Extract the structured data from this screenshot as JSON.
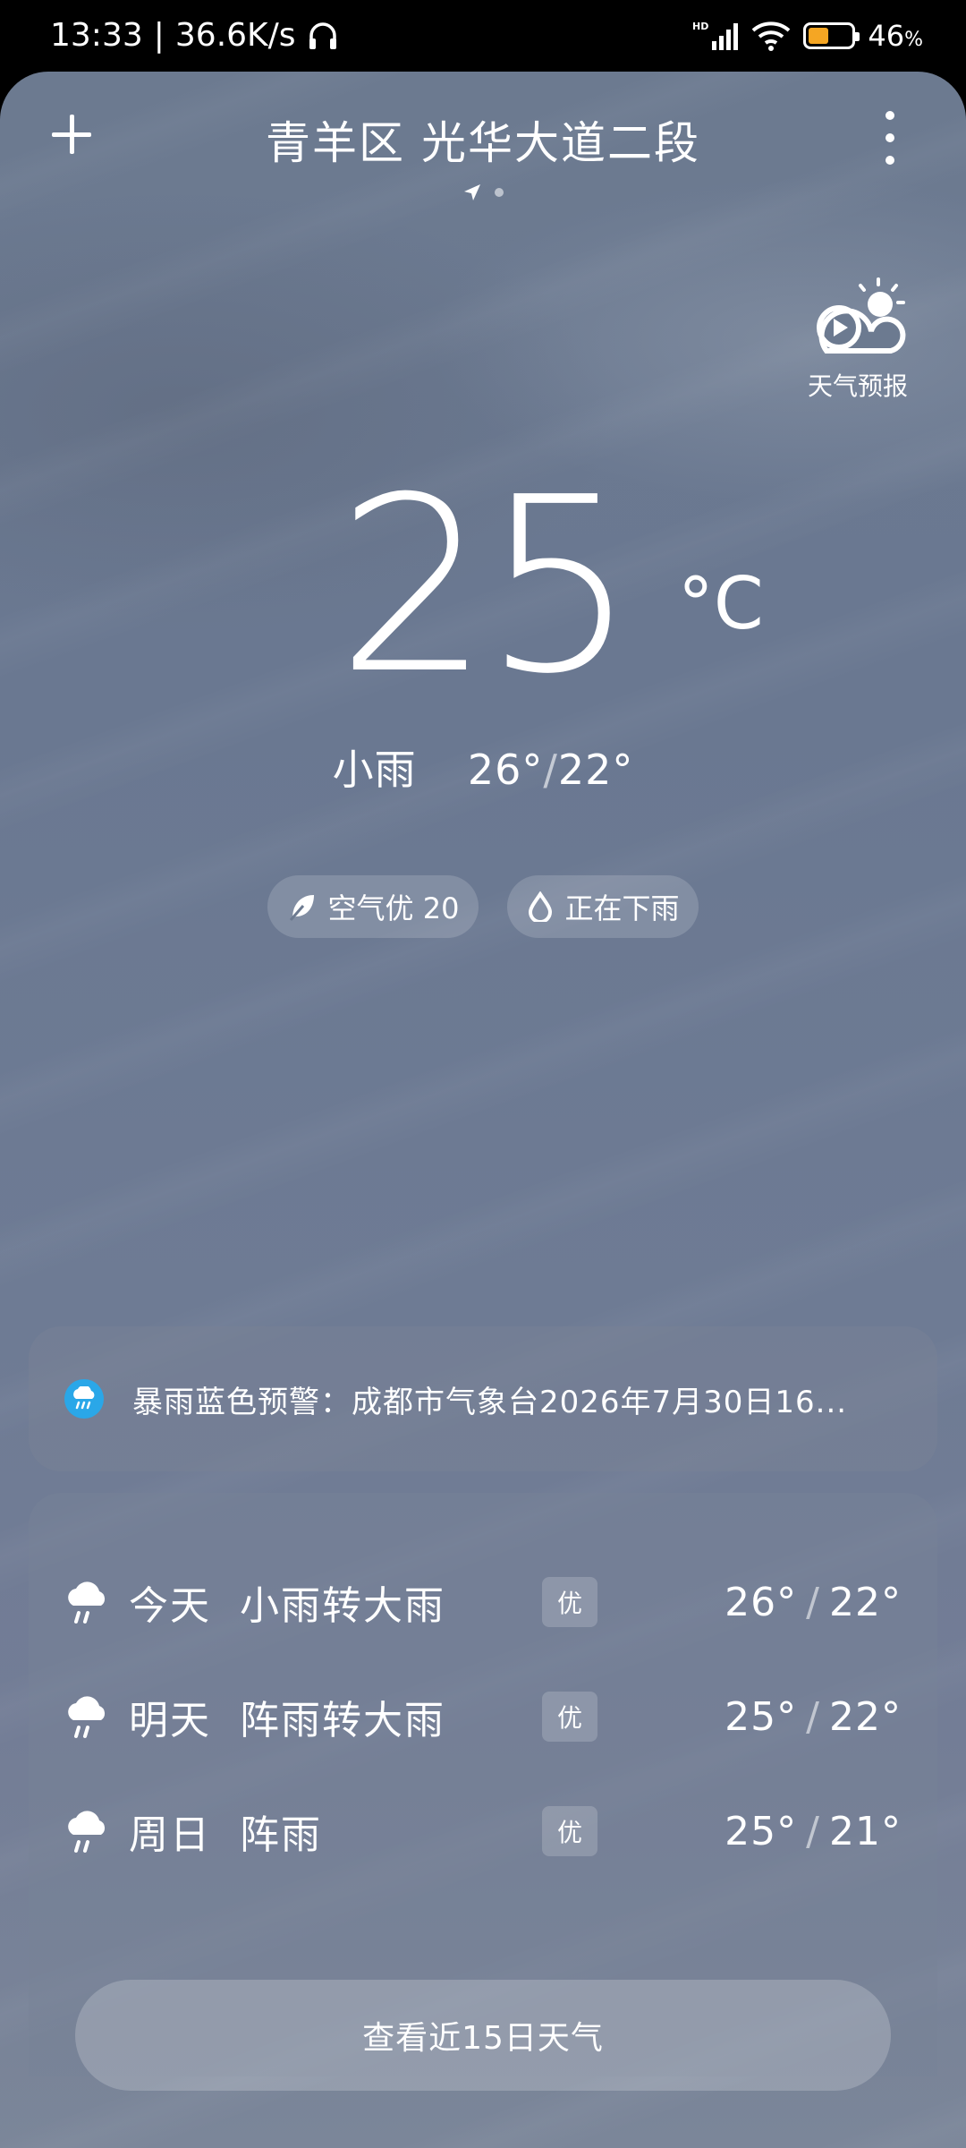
{
  "status_bar": {
    "time": "13:33",
    "network_speed": "36.6K/s",
    "signal_label": "HD",
    "battery_percent": "46",
    "battery_level": 0.46,
    "percent_sign": "%"
  },
  "header": {
    "location": "青羊区 光华大道二段",
    "forecast_video_label": "天气预报"
  },
  "current": {
    "temperature": "25",
    "unit": "°C",
    "condition": "小雨",
    "high": "26°",
    "low": "22°",
    "separator": "/"
  },
  "chips": {
    "air_quality": "空气优 20",
    "rain_status": "正在下雨"
  },
  "alert": {
    "text": "暴雨蓝色预警：成都市气象台2026年7月30日16..."
  },
  "forecast": [
    {
      "day": "今天",
      "condition": "小雨转大雨",
      "aqi": "优",
      "high": "26°",
      "low": "22°"
    },
    {
      "day": "明天",
      "condition": "阵雨转大雨",
      "aqi": "优",
      "high": "25°",
      "low": "22°"
    },
    {
      "day": "周日",
      "condition": "阵雨",
      "aqi": "优",
      "high": "25°",
      "low": "21°"
    }
  ],
  "forecast_separator": "/",
  "view_15_days_label": "查看近15日天气",
  "colors": {
    "alert_icon": "#2aa7e8",
    "battery_fill": "#f5a623"
  }
}
